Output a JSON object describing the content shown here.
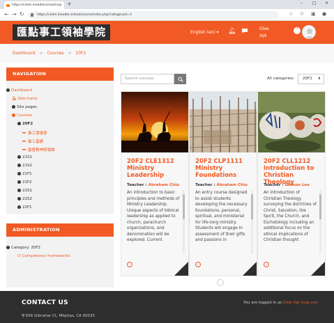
{
  "browser": {
    "tab_title": "https://ciomi.moodleschool/co",
    "url": "https://ciomi.moodle.school/course/index.php?categoryid=3",
    "window_controls": [
      "–",
      "□",
      "×"
    ]
  },
  "header": {
    "logo": "匯點事工領袖學院",
    "language": "English (en)",
    "username_line1": "Glee",
    "username_line2": "Xpt"
  },
  "breadcrumb": {
    "items": [
      "Dashboard",
      "Courses",
      "20F2"
    ],
    "separator": ">"
  },
  "navigation": {
    "title": "NAVIGATION",
    "dashboard": "Dashboard",
    "site_home": "Site home",
    "site_pages": "Site pages",
    "courses": "Courses",
    "current_category": "20F2",
    "current_courses": [
      "事工領導學",
      "事工基礎",
      "基督教神學導論"
    ],
    "other_categories": [
      "21S1",
      "21S2",
      "21F1",
      "21F2",
      "22S1",
      "22S2",
      "22F1"
    ]
  },
  "administration": {
    "title": "ADMINISTRATION",
    "category": "Category: 20F2",
    "competency": "Competency frameworks"
  },
  "main": {
    "search_placeholder": "Search courses",
    "categories_label": "All categories:",
    "categories_selected": "20F2"
  },
  "courses": [
    {
      "title": "20F2 CLE1312 Ministry Leadership",
      "teacher_label": "Teacher :",
      "teacher": "Abraham Chiu",
      "summary": "An introduction to basic principles and methods of Ministry Leadership. Unique aspects of biblical leadership as applied to church, parachurch organizations, and denomination will be explored. Current"
    },
    {
      "title": "20F2 CLP1111 Ministry Foundations",
      "teacher_label": "Teacher :",
      "teacher": "Abraham Chiu",
      "summary": "An entry course designed to assist students developing the necessary foundations, personal, spiritual, and ministerial for life-long ministry. Students will engage in assessment of their gifts and passions in"
    },
    {
      "title": "20F2 CLL1212 Introduction to Christian Theology",
      "teacher_label": "Teacher :",
      "teacher": "Gideon Lee",
      "summary": "An introduction of Christian Theology surveying the doctrines of Christ, Salvation, the Spirit, the Church, and Eschatology including an additional focus on the ethical implications of Christian thought"
    }
  ],
  "footer": {
    "contact_title": "CONTACT US",
    "address": "656 Gibraltar Ct, Milpitas, CA 95035",
    "logged_in_prefix": "You are logged in as",
    "logged_in_user": "Glee Xpt",
    "logout": "(Log out)"
  },
  "colors": {
    "brand": "#f15a24",
    "dark": "#2e2e2e"
  }
}
